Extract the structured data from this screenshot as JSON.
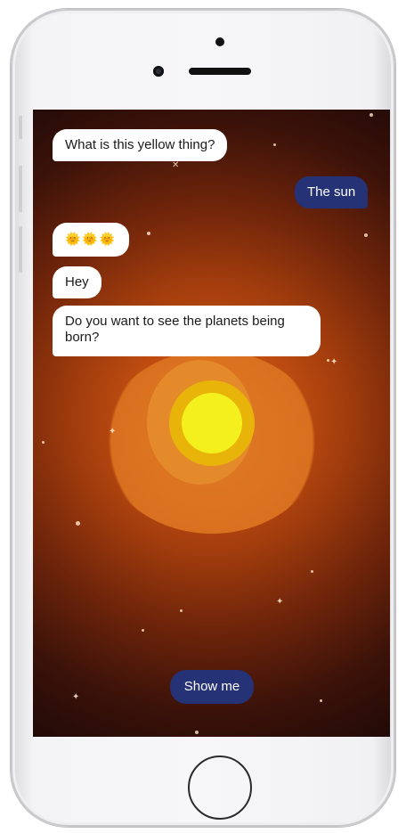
{
  "chat": {
    "messages": [
      {
        "from": "bot",
        "text": "What is this yellow thing?"
      },
      {
        "from": "user",
        "text": "The sun"
      },
      {
        "from": "bot",
        "text": "🌞🌞🌞"
      },
      {
        "from": "bot",
        "text": "Hey"
      },
      {
        "from": "bot",
        "text": "Do you want to see the planets being born?"
      }
    ],
    "reply_button": "Show me"
  },
  "colors": {
    "user_bubble": "#253276",
    "bot_bubble": "#ffffff",
    "sun_core": "#f4f01e",
    "sun_ring": "#e8b40a"
  }
}
